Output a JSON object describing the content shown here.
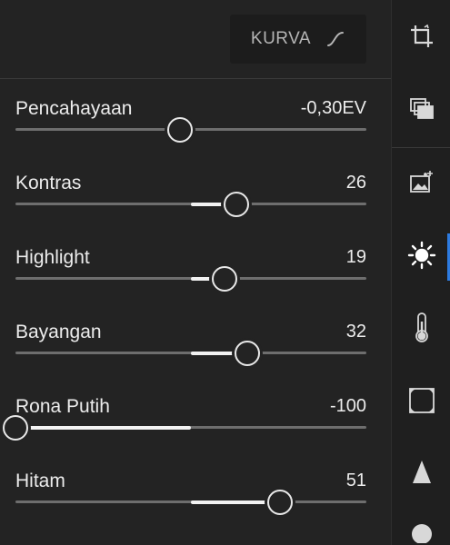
{
  "header": {
    "curve_button_label": "KURVA"
  },
  "sliders": [
    {
      "label": "Pencahayaan",
      "value": "-0,30EV",
      "position": 0.47,
      "centered": false
    },
    {
      "label": "Kontras",
      "value": "26",
      "position": 0.63,
      "centered": true
    },
    {
      "label": "Highlight",
      "value": "19",
      "position": 0.595,
      "centered": true
    },
    {
      "label": "Bayangan",
      "value": "32",
      "position": 0.66,
      "centered": true
    },
    {
      "label": "Rona Putih",
      "value": "-100",
      "position": 0.0,
      "centered": true
    },
    {
      "label": "Hitam",
      "value": "51",
      "position": 0.755,
      "centered": true
    }
  ],
  "sidebar": {
    "items": [
      {
        "name": "crop-icon"
      },
      {
        "name": "presets-icon"
      },
      {
        "name": "auto-enhance-icon"
      },
      {
        "name": "light-icon",
        "active": true
      },
      {
        "name": "color-temperature-icon"
      },
      {
        "name": "vignette-effects-icon"
      },
      {
        "name": "detail-icon"
      }
    ]
  },
  "colors": {
    "background": "#232323",
    "active_accent": "#2d7be0",
    "track": "#6e6e6e",
    "fill": "#f2f2f2"
  }
}
